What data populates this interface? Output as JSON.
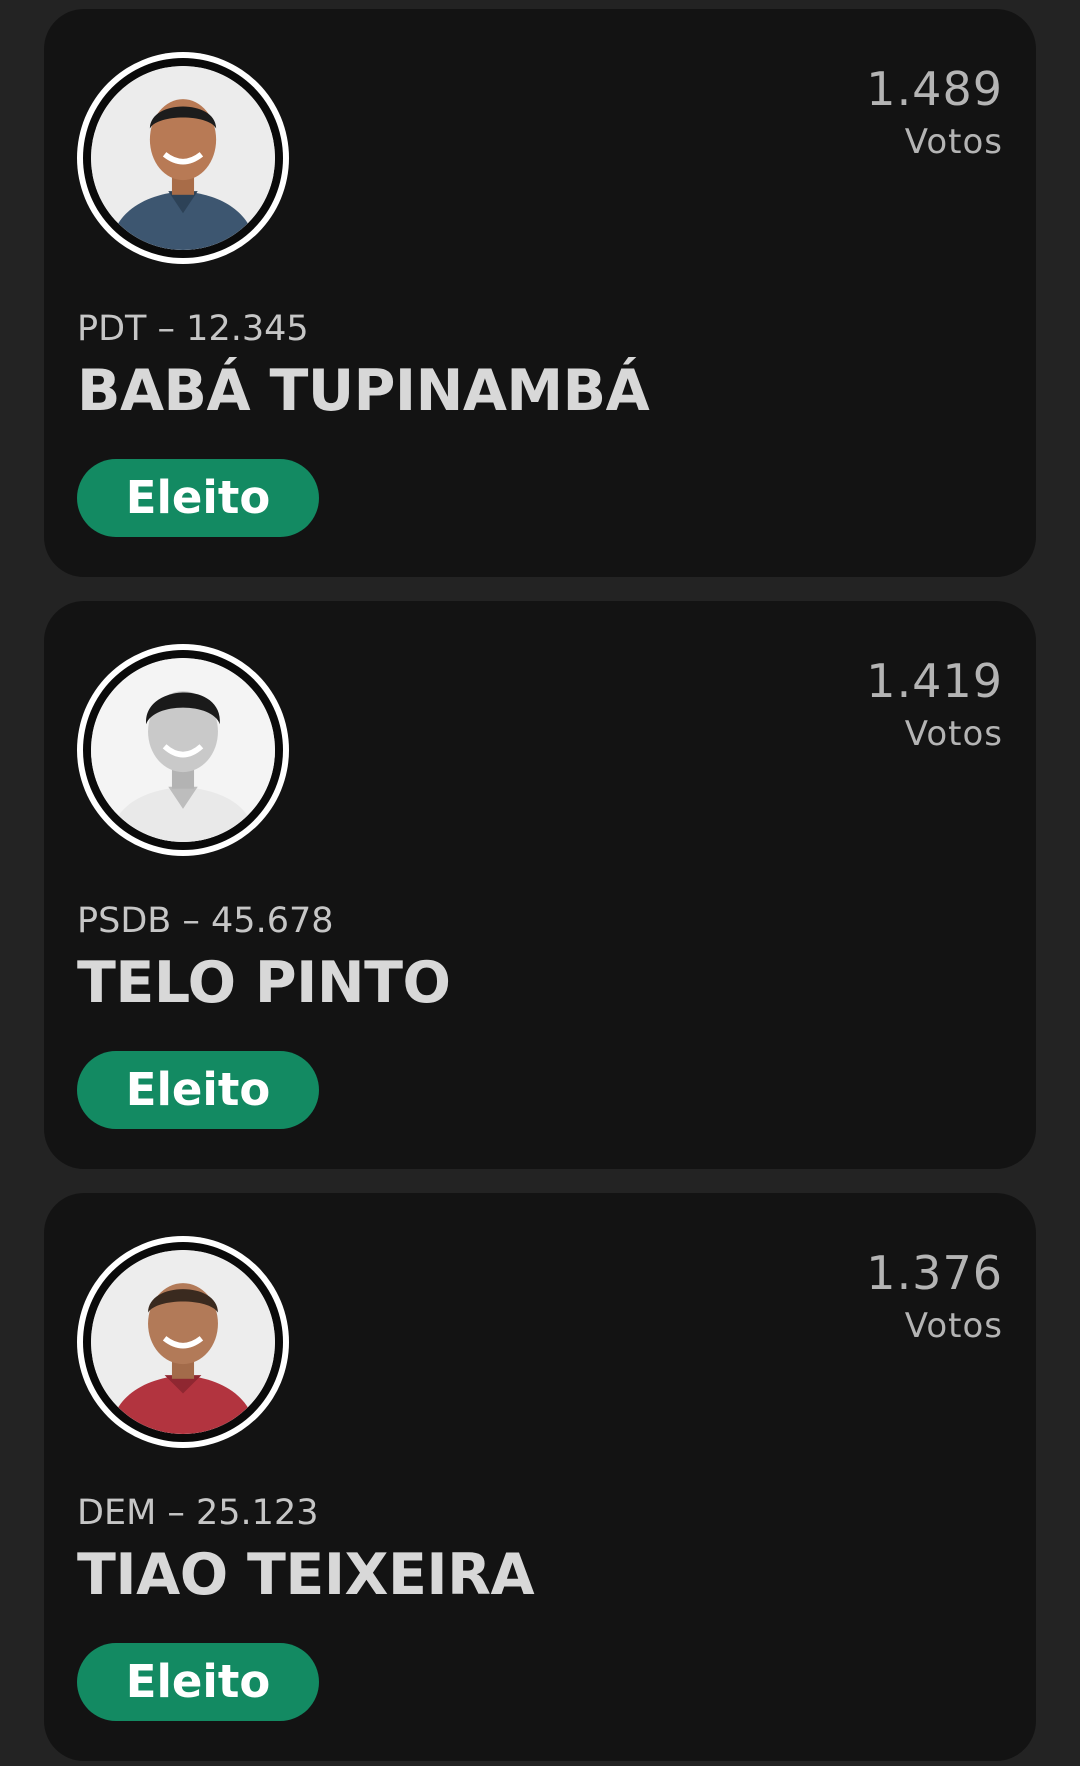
{
  "candidates": [
    {
      "party_number": "PDT – 12.345",
      "name": "BABÁ TUPINAMBÁ",
      "votes": "1.489",
      "votes_label": "Votos",
      "status": "Eleito"
    },
    {
      "party_number": "PSDB – 45.678",
      "name": "TELO PINTO",
      "votes": "1.419",
      "votes_label": "Votos",
      "status": "Eleito"
    },
    {
      "party_number": "DEM – 25.123",
      "name": "TIAO TEIXEIRA",
      "votes": "1.376",
      "votes_label": "Votos",
      "status": "Eleito"
    }
  ],
  "colors": {
    "page_background": "#232323",
    "card_background": "#131313",
    "badge_green": "#138a62",
    "shirt_colors": [
      "#3d5670",
      "#e9e9e9",
      "#b2343f"
    ],
    "skin_colors": [
      "#b87a55",
      "#c9c9c9",
      "#b27a58"
    ]
  }
}
